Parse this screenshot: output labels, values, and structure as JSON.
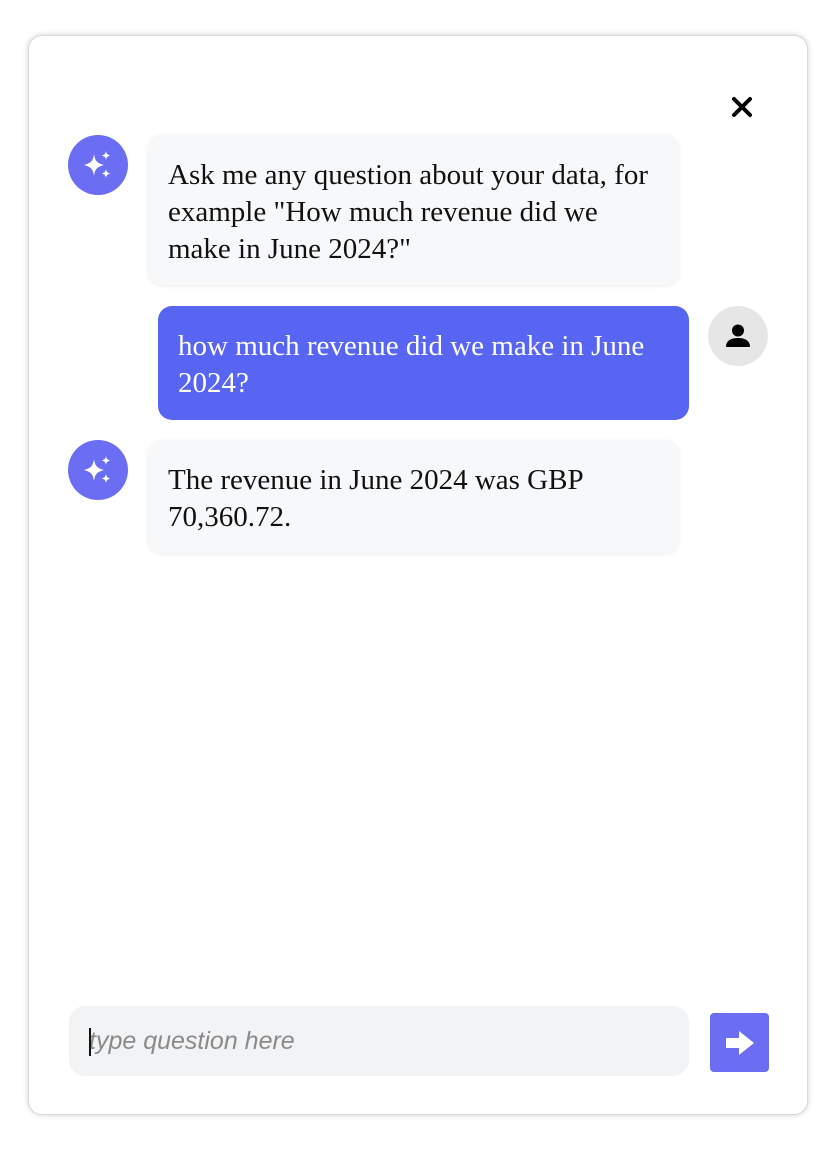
{
  "colors": {
    "accent": "#6b6ef2",
    "user_bubble": "#5865f2",
    "bot_bubble": "#f7f8fa",
    "input_bg": "#f2f3f5"
  },
  "header": {
    "close_icon": "close-icon"
  },
  "messages": [
    {
      "role": "assistant",
      "avatar_icon": "sparkles-icon",
      "text": "Ask me any question about your data, for example \"How much revenue did we make in June 2024?\""
    },
    {
      "role": "user",
      "avatar_icon": "person-icon",
      "text": "how much revenue did we make in June 2024?"
    },
    {
      "role": "assistant",
      "avatar_icon": "sparkles-icon",
      "text": "The revenue in June 2024 was GBP 70,360.72."
    }
  ],
  "composer": {
    "placeholder": "type question here",
    "value": "",
    "send_icon": "arrow-right-icon"
  }
}
